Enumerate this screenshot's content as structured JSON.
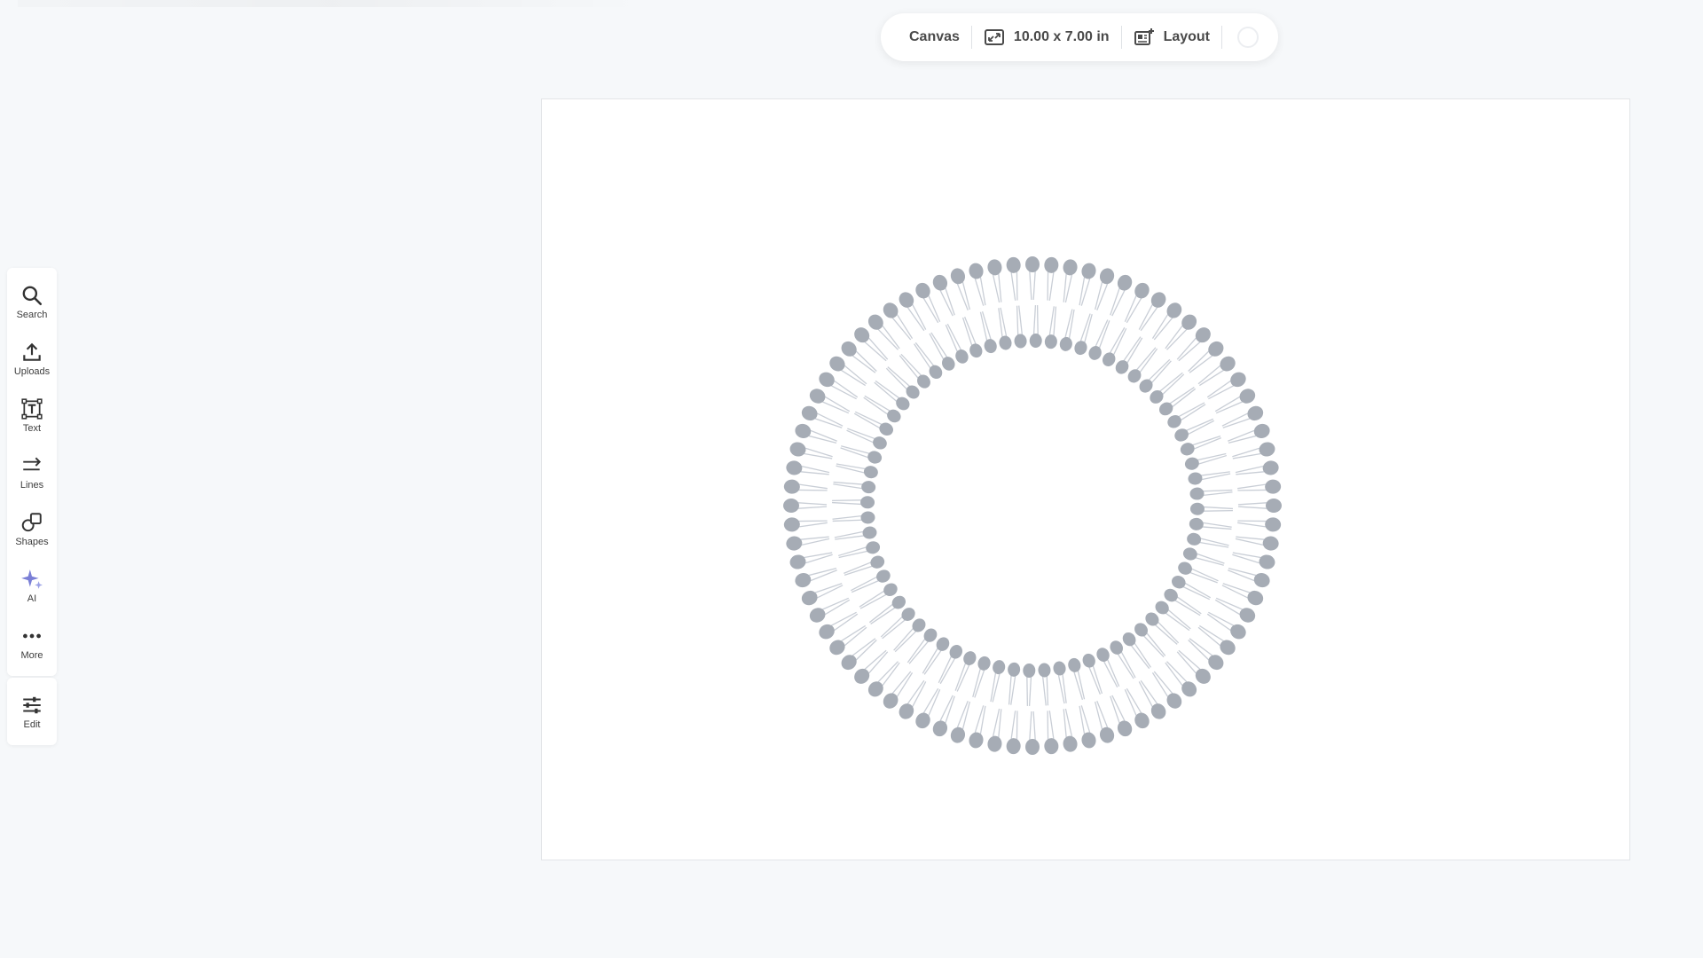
{
  "toolbar": {
    "canvas_label": "Canvas",
    "size_label": "10.00 x 7.00 in",
    "layout_label": "Layout"
  },
  "sidebar": {
    "items": [
      {
        "label": "Search",
        "icon": "search-icon"
      },
      {
        "label": "Uploads",
        "icon": "upload-icon"
      },
      {
        "label": "Text",
        "icon": "text-icon"
      },
      {
        "label": "Lines",
        "icon": "lines-icon"
      },
      {
        "label": "Shapes",
        "icon": "shapes-icon"
      },
      {
        "label": "AI",
        "icon": "ai-sparkle-icon"
      },
      {
        "label": "More",
        "icon": "more-icon"
      }
    ],
    "edit": {
      "label": "Edit",
      "icon": "edit-sliders-icon"
    }
  },
  "colors": {
    "page_background": "#f6f8fa",
    "canvas_background": "#ffffff",
    "lipid_head": "#a6acb5",
    "lipid_tail": "#c9ced6",
    "ai_accent": "#7a7fd6"
  },
  "canvas_content": {
    "figure": "lipid-bilayer-vesicle",
    "outer_heads": 80,
    "inner_heads": 68
  }
}
